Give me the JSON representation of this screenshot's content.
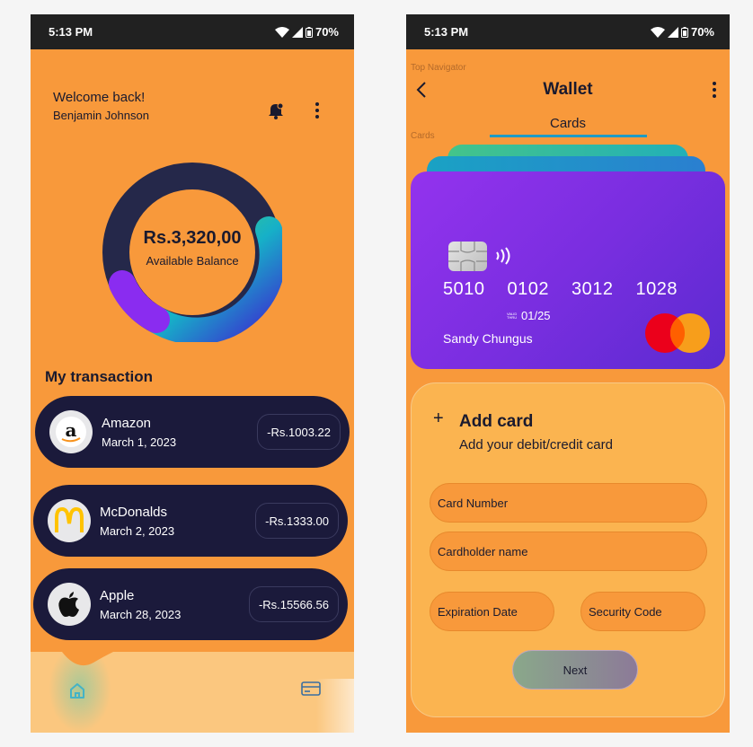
{
  "status_bar": {
    "time": "5:13 PM",
    "battery": "70%"
  },
  "home": {
    "welcome": "Welcome back!",
    "user_name": "Benjamin Johnson",
    "balance_amount": "Rs.3,320,00",
    "balance_label": "Available Balance",
    "section_title": "My transaction",
    "transactions": [
      {
        "name": "Amazon",
        "date": "March 1, 2023",
        "amount": "-Rs.1003.22",
        "logo": "amazon-logo"
      },
      {
        "name": "McDonalds",
        "date": "March 2, 2023",
        "amount": "-Rs.1333.00",
        "logo": "mcdonalds-logo"
      },
      {
        "name": "Apple",
        "date": "March 28, 2023",
        "amount": "-Rs.15566.56",
        "logo": "apple-logo"
      }
    ],
    "nav": {
      "items": [
        "home-icon",
        "card-icon"
      ]
    }
  },
  "wallet": {
    "annotation_top": "Top Navigator",
    "annotation_cards": "Cards",
    "title": "Wallet",
    "tab": "Cards",
    "card": {
      "number_groups": [
        "5010",
        "0102",
        "3012",
        "1028"
      ],
      "valid_thru_line1": "VALID",
      "valid_thru_line2": "THRU",
      "expiry": "01/25",
      "holder": "Sandy Chungus"
    },
    "form": {
      "plus": "+",
      "title": "Add card",
      "subtitle": "Add your debit/credit card",
      "card_number": "Card Number",
      "cardholder_name": "Cardholder name",
      "expiration_date": "Expiration Date",
      "security_code": "Security Code",
      "next": "Next"
    }
  },
  "colors": {
    "background": "#f8993b",
    "dark": "#1b1a3b",
    "accent_teal": "#1e9bc4",
    "card_purple": "#9333ee"
  }
}
